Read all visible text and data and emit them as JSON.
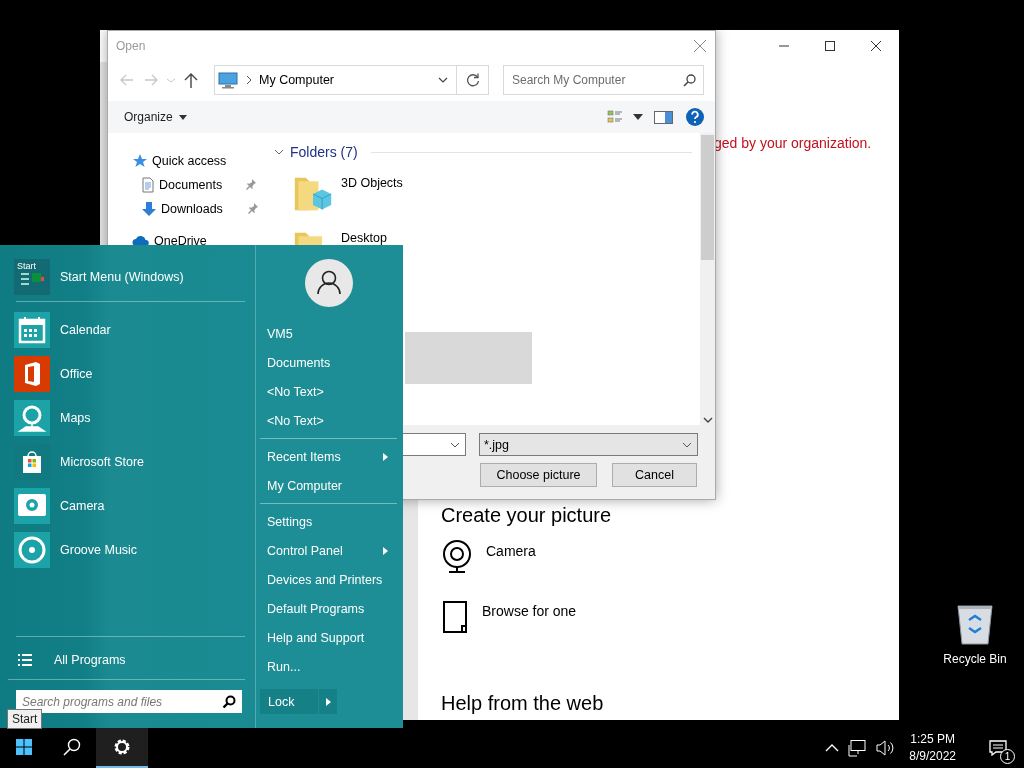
{
  "settings_window": {
    "notice": "ged by your organization.",
    "create_heading": "Create your picture",
    "options": [
      {
        "kind": "camera",
        "label": "Camera"
      },
      {
        "kind": "browse",
        "label": "Browse for one"
      }
    ],
    "help_heading": "Help from the web"
  },
  "open_dialog": {
    "title": "Open",
    "address": "My Computer",
    "search": {
      "placeholder": "Search My Computer"
    },
    "organize": "Organize",
    "nav_pane": [
      {
        "kind": "quick-access",
        "label": "Quick access",
        "pinned": false
      },
      {
        "kind": "documents",
        "label": "Documents",
        "pinned": true
      },
      {
        "kind": "downloads",
        "label": "Downloads",
        "pinned": true
      },
      {
        "kind": "onedrive",
        "label": "OneDrive",
        "pinned": false
      }
    ],
    "group": {
      "label": "Folders (7)",
      "expanded": true
    },
    "folders": [
      {
        "kind": "objects",
        "label": "3D Objects"
      },
      {
        "kind": "desktop",
        "label": "Desktop"
      }
    ],
    "file_type": "*.jpg",
    "buttons": [
      "Choose picture",
      "Cancel"
    ]
  },
  "start_menu": {
    "header": {
      "label": "Start Menu (Windows)",
      "icon_label": "Start"
    },
    "apps": [
      {
        "kind": "calendar",
        "label": "Calendar"
      },
      {
        "kind": "office",
        "label": "Office"
      },
      {
        "kind": "maps",
        "label": "Maps"
      },
      {
        "kind": "store",
        "label": "Microsoft Store"
      },
      {
        "kind": "camera",
        "label": "Camera"
      },
      {
        "kind": "music",
        "label": "Groove Music"
      }
    ],
    "all_programs": "All Programs",
    "search": {
      "placeholder": "Search programs and files"
    },
    "user_groups": [
      [
        {
          "label": "VM5",
          "submenu": false
        },
        {
          "label": "Documents",
          "submenu": false
        },
        {
          "label": "<No Text>",
          "submenu": false
        },
        {
          "label": "<No Text>",
          "submenu": false
        }
      ],
      [
        {
          "label": "Recent Items",
          "submenu": true
        },
        {
          "label": "My Computer",
          "submenu": false
        }
      ],
      [
        {
          "label": "Settings",
          "submenu": false
        },
        {
          "label": "Control Panel",
          "submenu": true
        },
        {
          "label": "Devices and Printers",
          "submenu": false
        },
        {
          "label": "Default Programs",
          "submenu": false
        },
        {
          "label": "Help and Support",
          "submenu": false
        },
        {
          "label": "Run...",
          "submenu": false
        }
      ]
    ],
    "lock": "Lock"
  },
  "tooltip": "Start",
  "taskbar": {
    "buttons": [
      {
        "kind": "start",
        "selected": false
      },
      {
        "kind": "search",
        "selected": false
      },
      {
        "kind": "settings",
        "selected": true
      }
    ],
    "time": "1:25 PM",
    "date": "8/9/2022",
    "notifications": "1"
  },
  "desktop_icons": [
    {
      "kind": "recycle-bin",
      "label": "Recycle Bin"
    }
  ]
}
